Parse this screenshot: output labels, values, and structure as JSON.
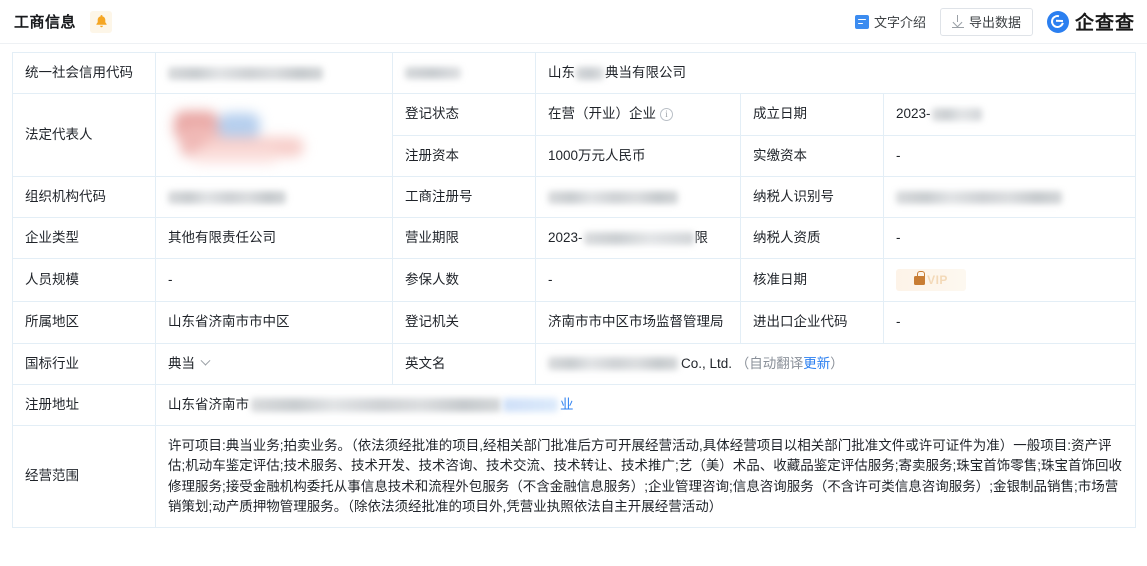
{
  "header": {
    "title": "工商信息",
    "bell_icon": "bell-icon",
    "text_intro_label": "文字介绍",
    "text_intro_icon": "document-icon",
    "export_label": "导出数据",
    "export_icon": "download-icon",
    "brand_name": "企查查",
    "brand_icon": "qcc-logo-icon"
  },
  "table": {
    "rows": {
      "credit_code_label": "统一社会信用代码",
      "credit_code_value": "",
      "company_short_label": "",
      "company_name_value": "山东",
      "company_name_suffix": "典当有限公司",
      "legal_person_label": "法定代表人",
      "legal_person_value": "",
      "reg_status_label": "登记状态",
      "reg_status_value": "在营（开业）企业",
      "establish_date_label": "成立日期",
      "establish_date_value": "2023-",
      "reg_capital_label": "注册资本",
      "reg_capital_value": "1000万元人民币",
      "paid_capital_label": "实缴资本",
      "paid_capital_value": "-",
      "org_code_label": "组织机构代码",
      "org_code_value": "",
      "business_reg_no_label": "工商注册号",
      "business_reg_no_value": "",
      "taxpayer_id_label": "纳税人识别号",
      "taxpayer_id_value": "",
      "company_type_label": "企业类型",
      "company_type_value": "其他有限责任公司",
      "business_term_label": "营业期限",
      "business_term_value": "2023-",
      "business_term_tail": "限",
      "taxpayer_qual_label": "纳税人资质",
      "taxpayer_qual_value": "-",
      "staff_size_label": "人员规模",
      "staff_size_value": "-",
      "insured_count_label": "参保人数",
      "insured_count_value": "-",
      "approval_date_label": "核准日期",
      "approval_date_value": "VIP",
      "region_label": "所属地区",
      "region_value": "山东省济南市市中区",
      "reg_authority_label": "登记机关",
      "reg_authority_value": "济南市市中区市场监督管理局",
      "import_export_code_label": "进出口企业代码",
      "import_export_code_value": "-",
      "industry_label": "国标行业",
      "industry_value": "典当",
      "english_name_label": "英文名",
      "english_name_value": "Co., Ltd.",
      "english_name_note_open": "（自动翻译",
      "english_name_note_link": "更新",
      "english_name_note_close": "）",
      "reg_address_label": "注册地址",
      "reg_address_value": "山东省济南市",
      "reg_address_tail": "业",
      "business_scope_label": "经营范围",
      "business_scope_value": "许可项目:典当业务;拍卖业务。（依法须经批准的项目,经相关部门批准后方可开展经营活动,具体经营项目以相关部门批准文件或许可证件为准）一般项目:资产评估;机动车鉴定评估;技术服务、技术开发、技术咨询、技术交流、技术转让、技术推广;艺（美）术品、收藏品鉴定评估服务;寄卖服务;珠宝首饰零售;珠宝首饰回收修理服务;接受金融机构委托从事信息技术和流程外包服务（不含金融信息服务）;企业管理咨询;信息咨询服务（不含许可类信息咨询服务）;金银制品销售;市场营销策划;动产质押物管理服务。（除依法须经批准的项目外,凭营业执照依法自主开展经营活动）"
    }
  },
  "colors": {
    "accent": "#2b7ff0",
    "label_bg": "#f2f8fc",
    "border": "#e3eef6",
    "vip": "#c87d35",
    "bell": "#f5a623"
  }
}
